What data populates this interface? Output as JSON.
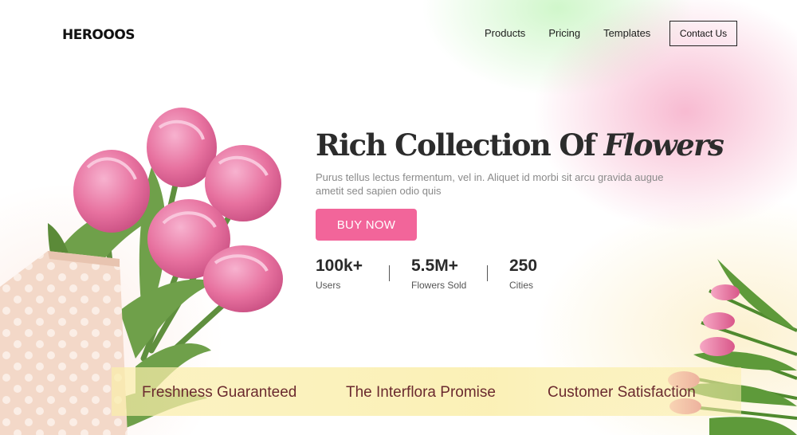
{
  "brand": {
    "logo_text": "HEROOOS"
  },
  "nav": {
    "items": [
      "Products",
      "Pricing",
      "Templates"
    ],
    "cta_label": "Contact Us"
  },
  "hero": {
    "title_regular": "Rich Collection Of ",
    "title_emphasis": "Flowers",
    "description": "Purus tellus lectus fermentum, vel in. Aliquet id morbi sit arcu gravida augue ametit sed sapien odio quis",
    "button_label": "BUY NOW"
  },
  "stats": [
    {
      "value": "100k+",
      "label": "Users"
    },
    {
      "value": "5.5M+",
      "label": "Flowers Sold"
    },
    {
      "value": "250",
      "label": "Cities"
    }
  ],
  "banner": {
    "items": [
      "Freshness Guaranteed",
      "The Interflora Promise",
      "Customer Satisfaction"
    ]
  },
  "colors": {
    "accent_pink": "#f2659a",
    "banner_yellow": "#faeeaa",
    "banner_text": "#6b2a2f"
  },
  "images": {
    "left": "pink-tulip-bouquet-in-polka-dot-wrap",
    "right": "pink-tulip-bunch"
  }
}
